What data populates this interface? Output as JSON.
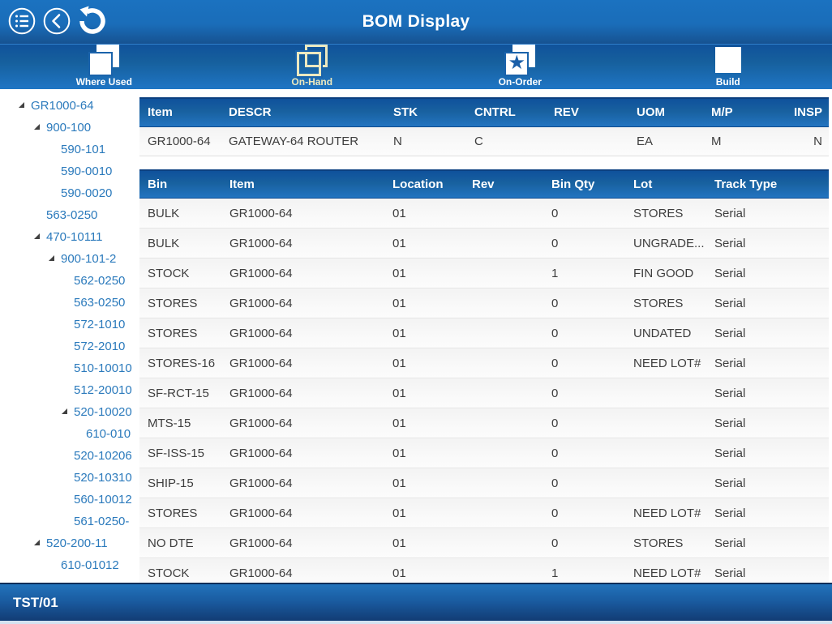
{
  "header": {
    "title": "BOM Display",
    "menu_icon": "menu-list-icon",
    "back_icon": "back-chevron-icon",
    "refresh_icon": "refresh-icon"
  },
  "toolbar": {
    "items": [
      {
        "label": "Where Used",
        "icon": "documents-filled-icon",
        "active": false
      },
      {
        "label": "On-Hand",
        "icon": "documents-outline-icon",
        "active": true
      },
      {
        "label": "On-Order",
        "icon": "document-star-icon",
        "active": false
      },
      {
        "label": "Build",
        "icon": "square-icon",
        "active": false
      }
    ],
    "active_color": "#ece9c0"
  },
  "tree": {
    "items": [
      {
        "label": "GR1000-64",
        "level": 0,
        "expanded": true
      },
      {
        "label": "900-100",
        "level": 1,
        "expanded": true
      },
      {
        "label": "590-101",
        "level": 2,
        "expanded": false
      },
      {
        "label": "590-0010",
        "level": 2,
        "expanded": false
      },
      {
        "label": "590-0020",
        "level": 2,
        "expanded": false
      },
      {
        "label": "563-0250",
        "level": 1,
        "expanded": false
      },
      {
        "label": "470-10111",
        "level": 1,
        "expanded": true
      },
      {
        "label": "900-101-2",
        "level": 2,
        "expanded": true
      },
      {
        "label": "562-0250",
        "level": 3,
        "expanded": false
      },
      {
        "label": "563-0250",
        "level": 3,
        "expanded": false
      },
      {
        "label": "572-1010",
        "level": 3,
        "expanded": false
      },
      {
        "label": "572-2010",
        "level": 3,
        "expanded": false
      },
      {
        "label": "510-10010",
        "level": 3,
        "expanded": false
      },
      {
        "label": "512-20010",
        "level": 3,
        "expanded": false
      },
      {
        "label": "520-10020",
        "level": 3,
        "expanded": true
      },
      {
        "label": "610-010",
        "level": 4,
        "expanded": false
      },
      {
        "label": "520-10206",
        "level": 3,
        "expanded": false
      },
      {
        "label": "520-10310",
        "level": 3,
        "expanded": false
      },
      {
        "label": "560-10012",
        "level": 3,
        "expanded": false
      },
      {
        "label": "561-0250-",
        "level": 3,
        "expanded": false
      },
      {
        "label": "520-200-11",
        "level": 1,
        "expanded": true
      },
      {
        "label": "610-01012",
        "level": 2,
        "expanded": false
      }
    ]
  },
  "item_table": {
    "columns": [
      "Item",
      "DESCR",
      "STK",
      "CNTRL",
      "REV",
      "UOM",
      "M/P",
      "INSP"
    ],
    "rows": [
      [
        "GR1000-64",
        "GATEWAY-64 ROUTER",
        "N",
        "C",
        "",
        "EA",
        "M",
        "N"
      ]
    ]
  },
  "bin_table": {
    "columns": [
      "Bin",
      "Item",
      "Location",
      "Rev",
      "Bin Qty",
      "Lot",
      "Track Type"
    ],
    "rows": [
      [
        "BULK",
        "GR1000-64",
        "01",
        "",
        "0",
        "STORES",
        "Serial"
      ],
      [
        "BULK",
        "GR1000-64",
        "01",
        "",
        "0",
        "UNGRADE...",
        "Serial"
      ],
      [
        "STOCK",
        "GR1000-64",
        "01",
        "",
        "1",
        "FIN GOOD",
        "Serial"
      ],
      [
        "STORES",
        "GR1000-64",
        "01",
        "",
        "0",
        "STORES",
        "Serial"
      ],
      [
        "STORES",
        "GR1000-64",
        "01",
        "",
        "0",
        "UNDATED",
        "Serial"
      ],
      [
        "STORES-16",
        "GR1000-64",
        "01",
        "",
        "0",
        "NEED LOT#",
        "Serial"
      ],
      [
        "SF-RCT-15",
        "GR1000-64",
        "01",
        "",
        "0",
        "",
        "Serial"
      ],
      [
        "MTS-15",
        "GR1000-64",
        "01",
        "",
        "0",
        "",
        "Serial"
      ],
      [
        "SF-ISS-15",
        "GR1000-64",
        "01",
        "",
        "0",
        "",
        "Serial"
      ],
      [
        "SHIP-15",
        "GR1000-64",
        "01",
        "",
        "0",
        "",
        "Serial"
      ],
      [
        "STORES",
        "GR1000-64",
        "01",
        "",
        "0",
        "NEED LOT#",
        "Serial"
      ],
      [
        "NO DTE",
        "GR1000-64",
        "01",
        "",
        "0",
        "STORES",
        "Serial"
      ],
      [
        "STOCK",
        "GR1000-64",
        "01",
        "",
        "1",
        "NEED LOT#",
        "Serial"
      ]
    ]
  },
  "footer": {
    "status": "TST/01"
  },
  "colors": {
    "header_blue": "#1a6db9",
    "toolbar_blue_top": "#10529b",
    "toolbar_blue_bottom": "#1f75c5",
    "grid_header_top": "#0f519c",
    "grid_header_bottom": "#2374c1",
    "tree_link_blue": "#2b7abc",
    "active_cream": "#ece9c0",
    "row_bg": "#f7f7f7",
    "footer_bottom_navy": "#123c74"
  }
}
